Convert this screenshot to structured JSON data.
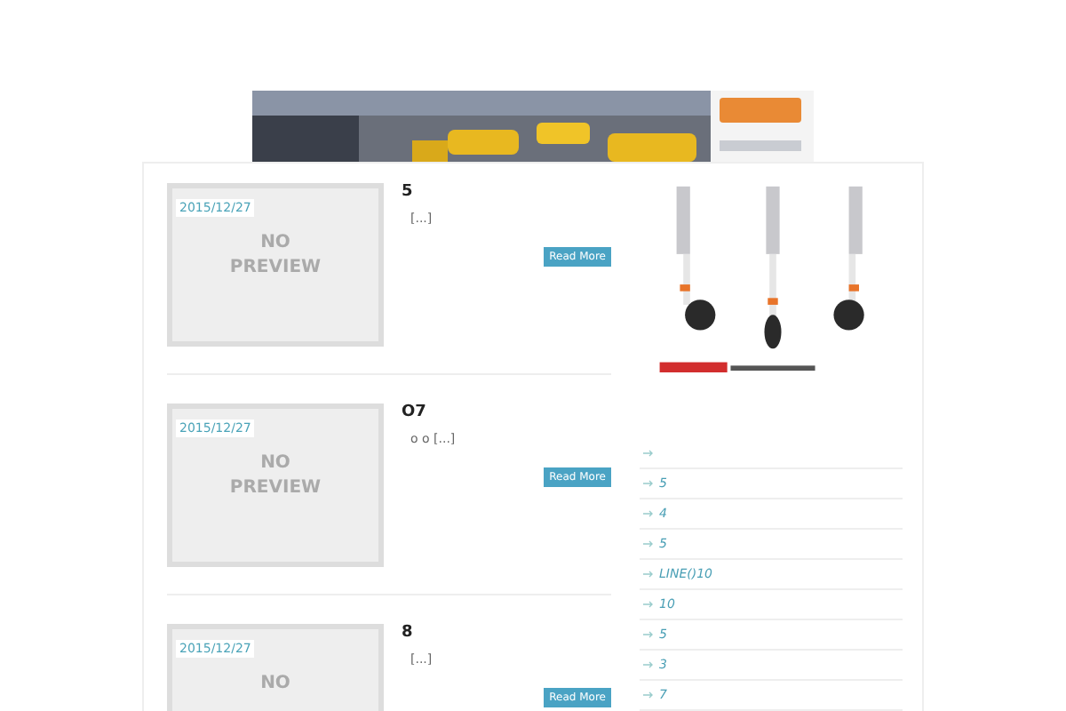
{
  "posts": [
    {
      "date": "2015/12/27",
      "thumb_lines": [
        "NO",
        "PREVIEW"
      ],
      "title": "5",
      "excerpt": "[...]",
      "read_more": "Read More"
    },
    {
      "date": "2015/12/27",
      "thumb_lines": [
        "NO",
        "PREVIEW"
      ],
      "title": "O7",
      "excerpt": "o o [...]",
      "read_more": "Read More"
    },
    {
      "date": "2015/12/27",
      "thumb_lines": [
        "NO"
      ],
      "title": "8",
      "excerpt": "[...]",
      "read_more": "Read More"
    }
  ],
  "sidebar": {
    "links": [
      {
        "kind": "blank"
      },
      {
        "kind": "link",
        "label": "5"
      },
      {
        "kind": "link",
        "label": "4"
      },
      {
        "kind": "link",
        "label": "5"
      },
      {
        "kind": "link",
        "label": "LINE()10"
      },
      {
        "kind": "link",
        "label": "10"
      },
      {
        "kind": "link",
        "label": "5"
      },
      {
        "kind": "link",
        "label": "3"
      },
      {
        "kind": "link",
        "label": "7"
      }
    ]
  }
}
